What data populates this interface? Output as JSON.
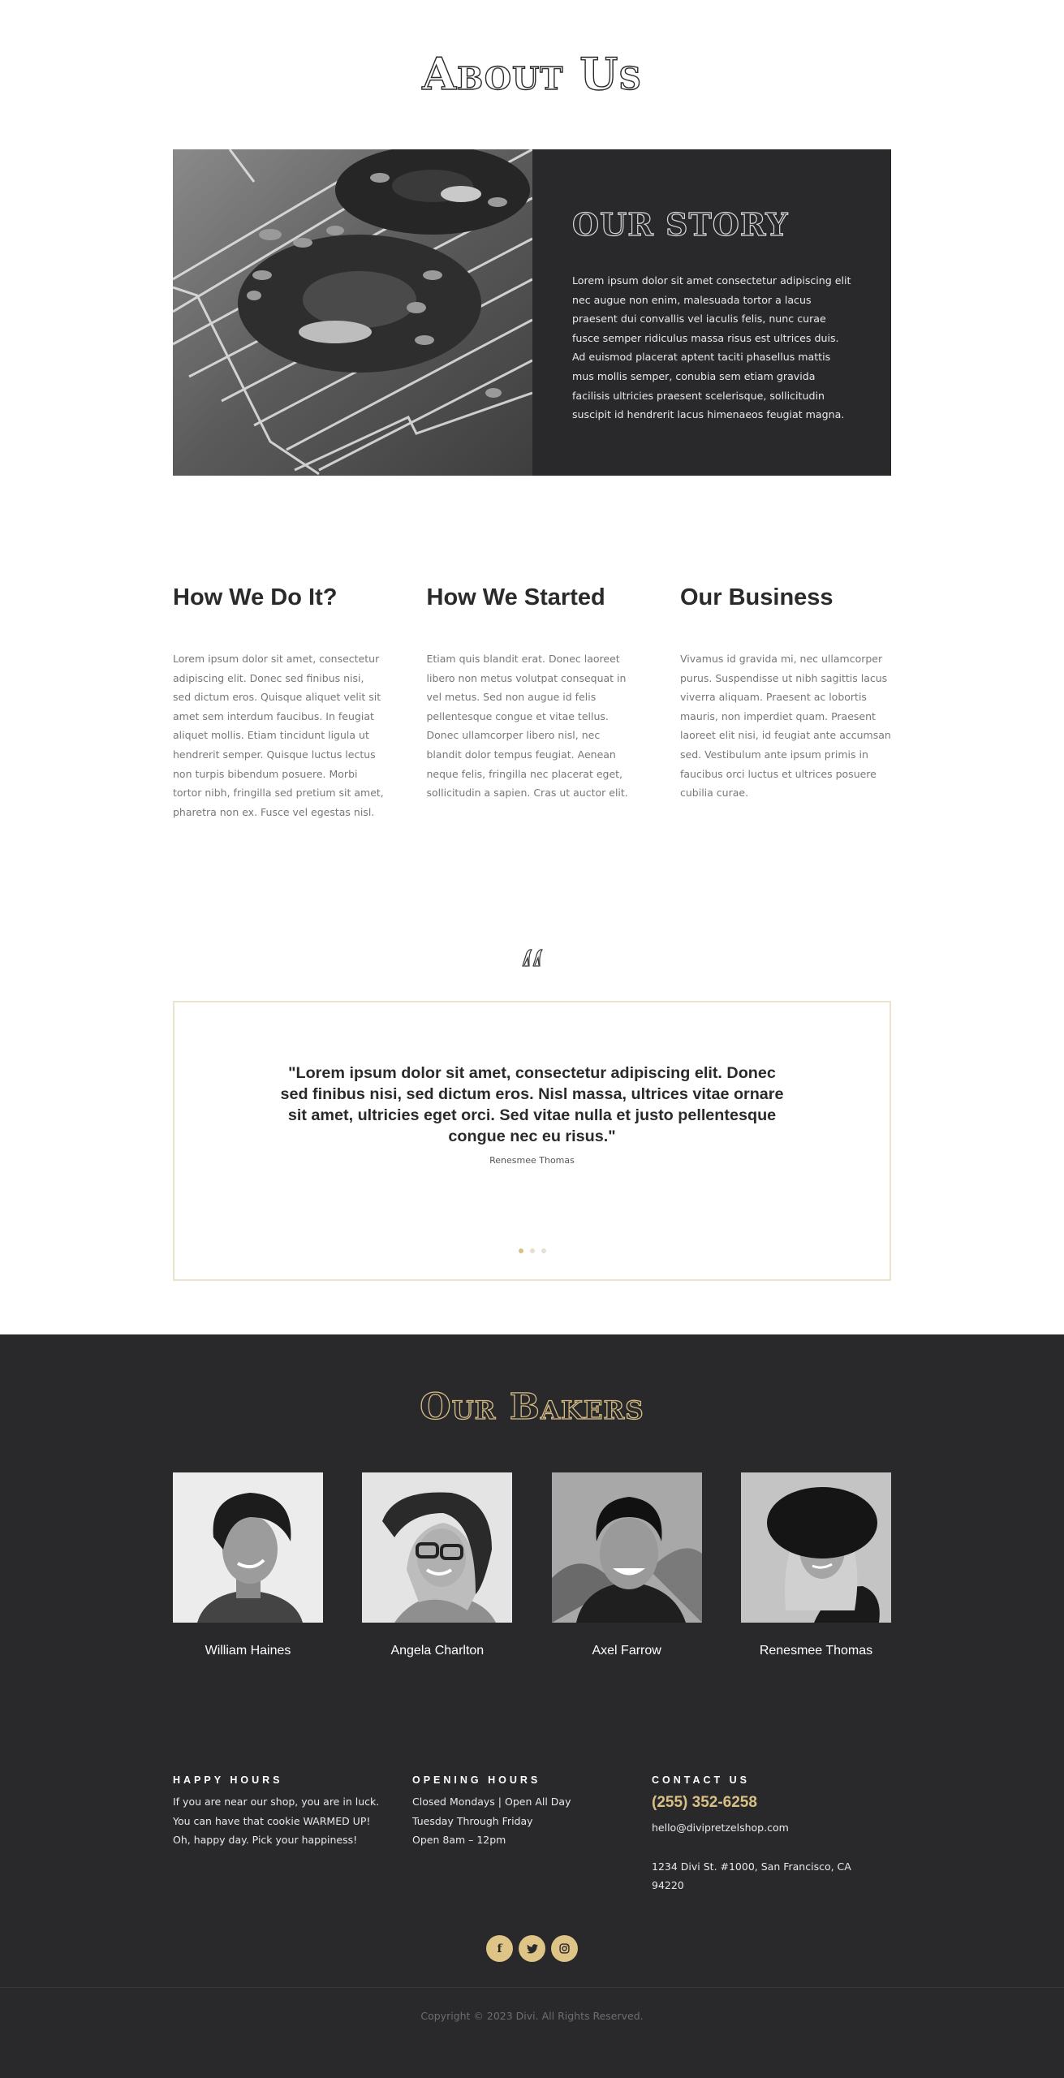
{
  "about": {
    "title": "About Us"
  },
  "story": {
    "image_alt": "pretzels-on-cooling-rack",
    "heading": "OUR STORY",
    "body": "Lorem ipsum dolor sit amet consectetur adipiscing elit nec augue non enim, malesuada tortor a lacus praesent dui convallis vel iaculis felis, nunc curae fusce semper ridiculus massa risus est ultrices duis. Ad euismod placerat aptent taciti phasellus mattis mus mollis semper, conubia sem etiam gravida facilisis ultricies praesent scelerisque, sollicitudin suscipit id hendrerit lacus himenaeos feugiat magna."
  },
  "columns": [
    {
      "heading": "How We Do It?",
      "body": "Lorem ipsum dolor sit amet, consectetur adipiscing elit. Donec sed finibus nisi, sed dictum eros. Quisque aliquet velit sit amet sem interdum faucibus. In feugiat aliquet mollis. Etiam tincidunt ligula ut hendrerit semper. Quisque luctus lectus non turpis bibendum posuere. Morbi tortor nibh, fringilla sed pretium sit amet, pharetra non ex. Fusce vel egestas nisl."
    },
    {
      "heading": "How We Started",
      "body": "Etiam quis blandit erat. Donec laoreet libero non metus volutpat consequat in vel metus. Sed non augue id felis pellentesque congue et vitae tellus. Donec ullamcorper libero nisl, nec blandit dolor tempus feugiat. Aenean neque felis, fringilla nec placerat eget, sollicitudin a sapien. Cras ut auctor elit."
    },
    {
      "heading": "Our Business",
      "body": "Vivamus id gravida mi, nec ullamcorper purus. Suspendisse ut nibh sagittis lacus viverra aliquam. Praesent ac lobortis mauris, non imperdiet quam. Praesent laoreet elit nisi, id feugiat ante accumsan sed. Vestibulum ante ipsum primis in faucibus orci luctus et ultrices posuere cubilia curae."
    }
  ],
  "testimonial": {
    "quote": "\"Lorem ipsum dolor sit amet, consectetur adipiscing elit. Donec sed finibus nisi, sed dictum eros. Nisl massa, ultrices vitae ornare sit amet, ultricies eget orci. Sed vitae nulla et justo pellentesque congue nec eu risus.\"",
    "author": "Renesmee Thomas",
    "slide_count": 3,
    "active_slide": 1
  },
  "bakers": {
    "title": "Our Bakers",
    "members": [
      {
        "name": "William Haines"
      },
      {
        "name": "Angela Charlton"
      },
      {
        "name": "Axel Farrow"
      },
      {
        "name": "Renesmee Thomas"
      }
    ]
  },
  "footer": {
    "happy_hours": {
      "heading": "HAPPY HOURS",
      "body": "If you are near our shop, you are in luck. You can have that cookie WARMED UP! Oh, happy day. Pick your happiness!"
    },
    "opening_hours": {
      "heading": "OPENING HOURS",
      "lines": [
        "Closed Mondays | Open All Day",
        "Tuesday Through Friday",
        "Open 8am – 12pm"
      ]
    },
    "contact": {
      "heading": "CONTACT US",
      "phone": "(255) 352-6258",
      "email": "hello@divipretzelshop.com",
      "address": "1234 Divi St. #1000, San Francisco, CA 94220"
    },
    "social": [
      {
        "icon": "facebook-icon",
        "glyph": "f"
      },
      {
        "icon": "twitter-icon",
        "glyph": "🐦"
      },
      {
        "icon": "instagram-icon",
        "glyph": "◎"
      }
    ],
    "copyright": "Copyright © 2023 Divi. All Rights Reserved."
  },
  "colors": {
    "dark_bg": "#29292c",
    "accent_gold": "#d8bf84",
    "border_cream": "#ece4cf"
  }
}
